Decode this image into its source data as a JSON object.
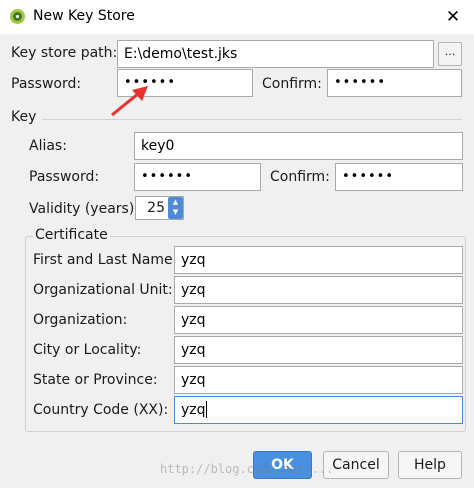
{
  "window": {
    "title": "New Key Store",
    "close_glyph": "✕"
  },
  "keystore": {
    "path_label": "Key store path:",
    "path_value": "E:\\demo\\test.jks",
    "browse_label": "...",
    "password_label": "Password:",
    "password_value": "••••••",
    "confirm_label": "Confirm:",
    "confirm_value": "••••••"
  },
  "key": {
    "section_label": "Key",
    "alias_label": "Alias:",
    "alias_value": "key0",
    "password_label": "Password:",
    "password_value": "••••••",
    "confirm_label": "Confirm:",
    "confirm_value": "••••••",
    "validity_label": "Validity (years):",
    "validity_value": "25",
    "spinner_up": "▲",
    "spinner_down": "▼"
  },
  "certificate": {
    "section_label": "Certificate",
    "fields": [
      {
        "label": "First and Last Name:",
        "value": "yzq"
      },
      {
        "label": "Organizational Unit:",
        "value": "yzq"
      },
      {
        "label": "Organization:",
        "value": "yzq"
      },
      {
        "label": "City or Locality:",
        "value": "yzq"
      },
      {
        "label": "State or Province:",
        "value": "yzq"
      },
      {
        "label": "Country Code (XX):",
        "value": "yzq"
      }
    ]
  },
  "buttons": {
    "ok": "OK",
    "cancel": "Cancel",
    "help": "Help"
  },
  "watermark": "http://blog.csdn.net/...",
  "colors": {
    "ok_button": "#4a90e2",
    "annotation_arrow": "#e8322e",
    "spinner": "#4a8ad6"
  }
}
